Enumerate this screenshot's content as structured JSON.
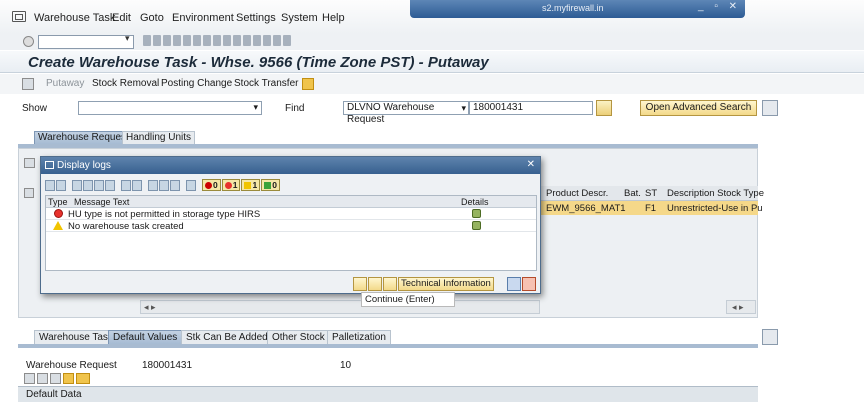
{
  "menu": {
    "items": [
      "Warehouse Task",
      "Edit",
      "Goto",
      "Environment",
      "Settings",
      "System",
      "Help"
    ]
  },
  "window": {
    "title": "s2.myfirewall.in",
    "controls": "_ ▫ ✕"
  },
  "page": {
    "title": "Create Warehouse Task - Whse. 9566 (Time Zone PST) - Putaway"
  },
  "app_toolbar": {
    "putaway": "Putaway",
    "stock_removal": "Stock Removal",
    "posting_change": "Posting Change",
    "stock_transfer": "Stock Transfer"
  },
  "search": {
    "show_label": "Show",
    "show_value": "",
    "find_label": "Find",
    "find_type": "DLVNO Warehouse Request",
    "find_value": "180001431",
    "advanced_button": "Open Advanced Search"
  },
  "upper_tabs": [
    {
      "label": "Warehouse Request",
      "active": true
    },
    {
      "label": "Handling Units",
      "active": false
    }
  ],
  "grid": {
    "columns": [
      "Product Descr.",
      "Bat.",
      "ST",
      "Description Stock Type"
    ],
    "rows": [
      [
        "EWM_9566_MAT1",
        "",
        "F1",
        "Unrestricted-Use in Pu"
      ]
    ]
  },
  "dialog": {
    "title": "Display logs",
    "counts": {
      "stop": "0",
      "error": "1",
      "warning": "1",
      "success": "0"
    },
    "columns": [
      "Type",
      "Message Text",
      "Details"
    ],
    "messages": [
      {
        "type": "error",
        "text": "HU type  is not permitted in storage type HIRS"
      },
      {
        "type": "warning",
        "text": "No warehouse task created"
      }
    ],
    "technical_button": "Technical Information",
    "tooltip": "Continue   (Enter)",
    "close": "✕"
  },
  "lower_tabs": [
    {
      "label": "Warehouse Task",
      "active": false
    },
    {
      "label": "Default Values",
      "active": true
    },
    {
      "label": "Stk Can Be Added",
      "active": false
    },
    {
      "label": "Other Stock",
      "active": false
    },
    {
      "label": "Palletization",
      "active": false
    }
  ],
  "lower": {
    "wr_label": "Warehouse Request",
    "wr_value": "180001431",
    "wr_item": "10",
    "default_data": "Default Data"
  },
  "colors": {
    "accent": "#37608f",
    "selected_row": "#f5d889",
    "error": "#e8322d",
    "warning": "#f1c400"
  }
}
